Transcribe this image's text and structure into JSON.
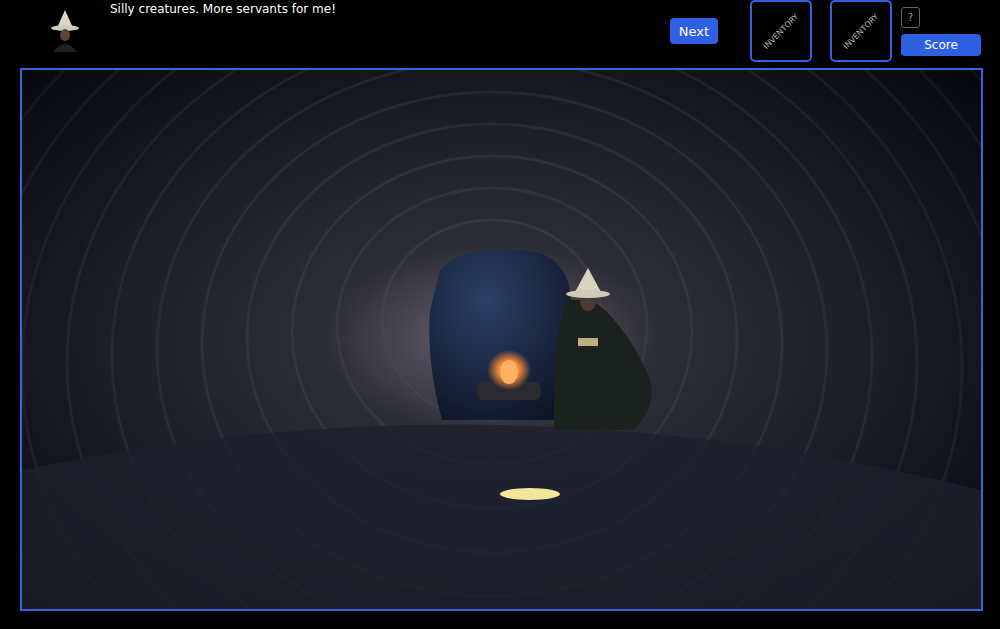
{
  "dialogue": {
    "text": "Silly creatures. More servants for me!"
  },
  "buttons": {
    "next": "Next",
    "help": "?",
    "score": "Score"
  },
  "inventory": [
    {
      "label": "INVENTORY"
    },
    {
      "label": "INVENTORY"
    }
  ]
}
